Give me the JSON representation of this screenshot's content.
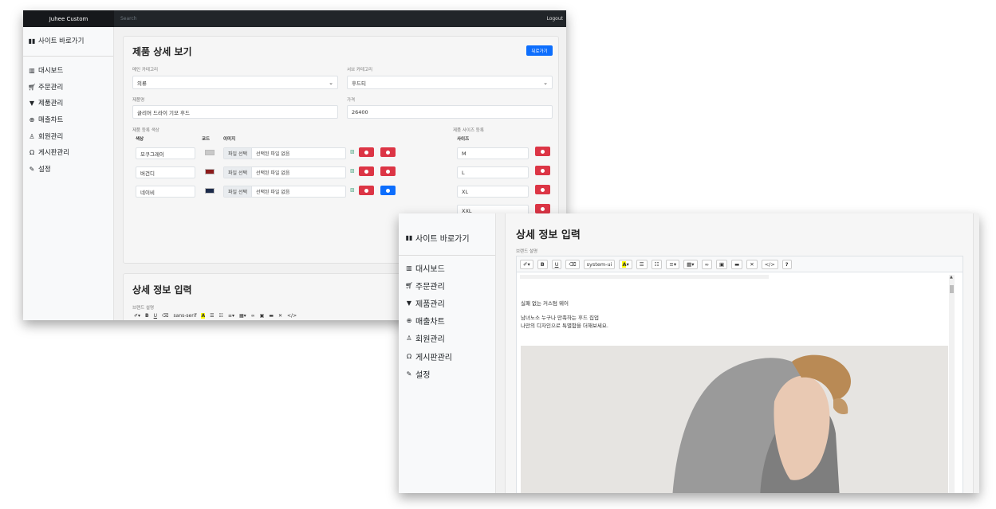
{
  "header": {
    "brand": "Juhee Custom",
    "search_placeholder": "Search",
    "logout": "Logout"
  },
  "sidebar": {
    "site_link": "사이트 바로가기",
    "items": [
      {
        "label": "대시보드",
        "icon": "table-icon"
      },
      {
        "label": "주문관리",
        "icon": "cart-icon"
      },
      {
        "label": "제품관리",
        "icon": "shirt-icon"
      },
      {
        "label": "매출차트",
        "icon": "search-chart-icon"
      },
      {
        "label": "회원관리",
        "icon": "person-icon"
      },
      {
        "label": "게시판관리",
        "icon": "headset-icon"
      },
      {
        "label": "설정",
        "icon": "wrench-icon"
      }
    ]
  },
  "product": {
    "title": "제품 상세 보기",
    "back_button": "뒤로가기",
    "main_category_label": "메인 카테고리",
    "main_category_value": "의류",
    "sub_category_label": "서브 카테고리",
    "sub_category_value": "후드티",
    "name_label": "제품명",
    "name_value": "글리머 드라이 기모 후드",
    "price_label": "가격",
    "price_value": "26400",
    "color_section_label": "제품 등록 색상",
    "size_section_label": "제품 사이즈 등록",
    "col_color": "색상",
    "col_code": "코드",
    "col_image": "이미지",
    "col_size": "사이즈",
    "file_button": "파일 선택",
    "file_none": "선택된 파일 없음",
    "colors": [
      {
        "name": "모쿠그레이",
        "hex": "#c9c9c9"
      },
      {
        "name": "버건디",
        "hex": "#8b1a1a"
      },
      {
        "name": "네이비",
        "hex": "#1c2a4a"
      }
    ],
    "sizes": [
      "M",
      "L",
      "XL",
      "XXL"
    ]
  },
  "detail": {
    "title": "상세 정보 입력",
    "brand_desc_label": "브랜드 설명",
    "toolbar_font_1": "sans-serif",
    "toolbar_font_2": "system-ui",
    "editor_lines": [
      "실패 없는 커스텀 웨어",
      "남녀노소 누구나 만족하는 후드 집업",
      "나만의 디자인으로 특별함을 더해보세요."
    ]
  },
  "colors": {
    "primary": "#0d6efd",
    "danger": "#dc3545",
    "topbar": "#212529"
  }
}
